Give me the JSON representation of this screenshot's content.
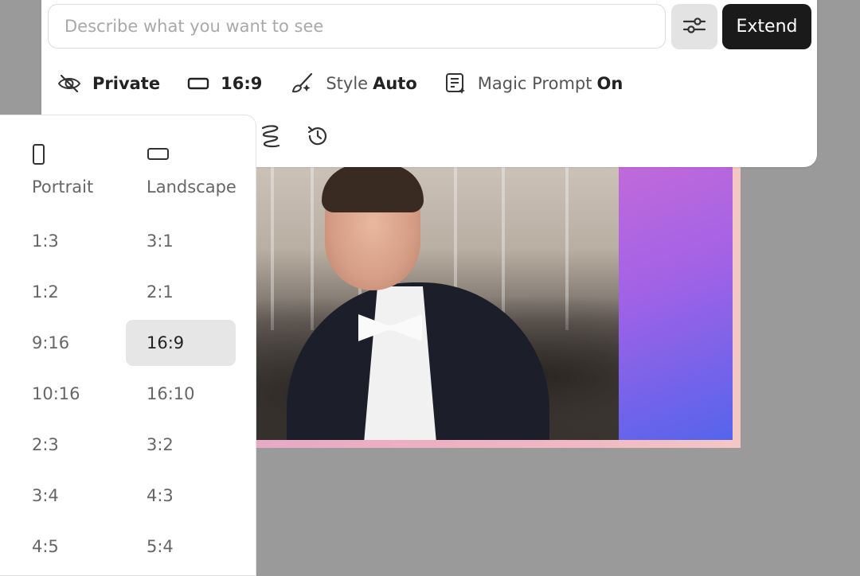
{
  "prompt": {
    "placeholder": "Describe what you want to see",
    "extend_label": "Extend"
  },
  "options": {
    "visibility": "Private",
    "aspect_ratio": "16:9",
    "style_label": "Style",
    "style_value": "Auto",
    "magic_prompt_label": "Magic Prompt",
    "magic_prompt_value": "On"
  },
  "icons": {
    "visibility": "eye-off-icon",
    "aspect": "rectangle-icon",
    "style": "brush-icon",
    "magic_prompt": "document-sparkle-icon",
    "settings": "sliders-icon",
    "squiggle": "squiggle-icon",
    "history": "history-icon"
  },
  "ratio_menu": {
    "portrait_label": "Portrait",
    "landscape_label": "Landscape",
    "portrait": [
      "1:3",
      "1:2",
      "9:16",
      "10:16",
      "2:3",
      "3:4",
      "4:5"
    ],
    "landscape": [
      "3:1",
      "2:1",
      "16:9",
      "16:10",
      "3:2",
      "4:3",
      "5:4"
    ],
    "selected": "16:9"
  },
  "colors": {
    "extend_button": "#1a1a1a",
    "background": "#9a9a9a",
    "selected_item": "#e6e6e6"
  }
}
